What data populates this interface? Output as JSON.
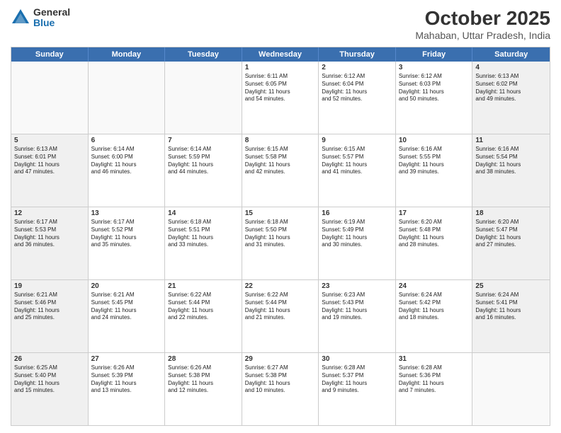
{
  "logo": {
    "general": "General",
    "blue": "Blue"
  },
  "title": "October 2025",
  "location": "Mahaban, Uttar Pradesh, India",
  "days": [
    "Sunday",
    "Monday",
    "Tuesday",
    "Wednesday",
    "Thursday",
    "Friday",
    "Saturday"
  ],
  "weeks": [
    [
      {
        "num": "",
        "text": "",
        "empty": true
      },
      {
        "num": "",
        "text": "",
        "empty": true
      },
      {
        "num": "",
        "text": "",
        "empty": true
      },
      {
        "num": "1",
        "text": "Sunrise: 6:11 AM\nSunset: 6:05 PM\nDaylight: 11 hours\nand 54 minutes.",
        "shaded": false
      },
      {
        "num": "2",
        "text": "Sunrise: 6:12 AM\nSunset: 6:04 PM\nDaylight: 11 hours\nand 52 minutes.",
        "shaded": false
      },
      {
        "num": "3",
        "text": "Sunrise: 6:12 AM\nSunset: 6:03 PM\nDaylight: 11 hours\nand 50 minutes.",
        "shaded": false
      },
      {
        "num": "4",
        "text": "Sunrise: 6:13 AM\nSunset: 6:02 PM\nDaylight: 11 hours\nand 49 minutes.",
        "shaded": true
      }
    ],
    [
      {
        "num": "5",
        "text": "Sunrise: 6:13 AM\nSunset: 6:01 PM\nDaylight: 11 hours\nand 47 minutes.",
        "shaded": true
      },
      {
        "num": "6",
        "text": "Sunrise: 6:14 AM\nSunset: 6:00 PM\nDaylight: 11 hours\nand 46 minutes.",
        "shaded": false
      },
      {
        "num": "7",
        "text": "Sunrise: 6:14 AM\nSunset: 5:59 PM\nDaylight: 11 hours\nand 44 minutes.",
        "shaded": false
      },
      {
        "num": "8",
        "text": "Sunrise: 6:15 AM\nSunset: 5:58 PM\nDaylight: 11 hours\nand 42 minutes.",
        "shaded": false
      },
      {
        "num": "9",
        "text": "Sunrise: 6:15 AM\nSunset: 5:57 PM\nDaylight: 11 hours\nand 41 minutes.",
        "shaded": false
      },
      {
        "num": "10",
        "text": "Sunrise: 6:16 AM\nSunset: 5:55 PM\nDaylight: 11 hours\nand 39 minutes.",
        "shaded": false
      },
      {
        "num": "11",
        "text": "Sunrise: 6:16 AM\nSunset: 5:54 PM\nDaylight: 11 hours\nand 38 minutes.",
        "shaded": true
      }
    ],
    [
      {
        "num": "12",
        "text": "Sunrise: 6:17 AM\nSunset: 5:53 PM\nDaylight: 11 hours\nand 36 minutes.",
        "shaded": true
      },
      {
        "num": "13",
        "text": "Sunrise: 6:17 AM\nSunset: 5:52 PM\nDaylight: 11 hours\nand 35 minutes.",
        "shaded": false
      },
      {
        "num": "14",
        "text": "Sunrise: 6:18 AM\nSunset: 5:51 PM\nDaylight: 11 hours\nand 33 minutes.",
        "shaded": false
      },
      {
        "num": "15",
        "text": "Sunrise: 6:18 AM\nSunset: 5:50 PM\nDaylight: 11 hours\nand 31 minutes.",
        "shaded": false
      },
      {
        "num": "16",
        "text": "Sunrise: 6:19 AM\nSunset: 5:49 PM\nDaylight: 11 hours\nand 30 minutes.",
        "shaded": false
      },
      {
        "num": "17",
        "text": "Sunrise: 6:20 AM\nSunset: 5:48 PM\nDaylight: 11 hours\nand 28 minutes.",
        "shaded": false
      },
      {
        "num": "18",
        "text": "Sunrise: 6:20 AM\nSunset: 5:47 PM\nDaylight: 11 hours\nand 27 minutes.",
        "shaded": true
      }
    ],
    [
      {
        "num": "19",
        "text": "Sunrise: 6:21 AM\nSunset: 5:46 PM\nDaylight: 11 hours\nand 25 minutes.",
        "shaded": true
      },
      {
        "num": "20",
        "text": "Sunrise: 6:21 AM\nSunset: 5:45 PM\nDaylight: 11 hours\nand 24 minutes.",
        "shaded": false
      },
      {
        "num": "21",
        "text": "Sunrise: 6:22 AM\nSunset: 5:44 PM\nDaylight: 11 hours\nand 22 minutes.",
        "shaded": false
      },
      {
        "num": "22",
        "text": "Sunrise: 6:22 AM\nSunset: 5:44 PM\nDaylight: 11 hours\nand 21 minutes.",
        "shaded": false
      },
      {
        "num": "23",
        "text": "Sunrise: 6:23 AM\nSunset: 5:43 PM\nDaylight: 11 hours\nand 19 minutes.",
        "shaded": false
      },
      {
        "num": "24",
        "text": "Sunrise: 6:24 AM\nSunset: 5:42 PM\nDaylight: 11 hours\nand 18 minutes.",
        "shaded": false
      },
      {
        "num": "25",
        "text": "Sunrise: 6:24 AM\nSunset: 5:41 PM\nDaylight: 11 hours\nand 16 minutes.",
        "shaded": true
      }
    ],
    [
      {
        "num": "26",
        "text": "Sunrise: 6:25 AM\nSunset: 5:40 PM\nDaylight: 11 hours\nand 15 minutes.",
        "shaded": true
      },
      {
        "num": "27",
        "text": "Sunrise: 6:26 AM\nSunset: 5:39 PM\nDaylight: 11 hours\nand 13 minutes.",
        "shaded": false
      },
      {
        "num": "28",
        "text": "Sunrise: 6:26 AM\nSunset: 5:38 PM\nDaylight: 11 hours\nand 12 minutes.",
        "shaded": false
      },
      {
        "num": "29",
        "text": "Sunrise: 6:27 AM\nSunset: 5:38 PM\nDaylight: 11 hours\nand 10 minutes.",
        "shaded": false
      },
      {
        "num": "30",
        "text": "Sunrise: 6:28 AM\nSunset: 5:37 PM\nDaylight: 11 hours\nand 9 minutes.",
        "shaded": false
      },
      {
        "num": "31",
        "text": "Sunrise: 6:28 AM\nSunset: 5:36 PM\nDaylight: 11 hours\nand 7 minutes.",
        "shaded": false
      },
      {
        "num": "",
        "text": "",
        "empty": true
      }
    ]
  ]
}
